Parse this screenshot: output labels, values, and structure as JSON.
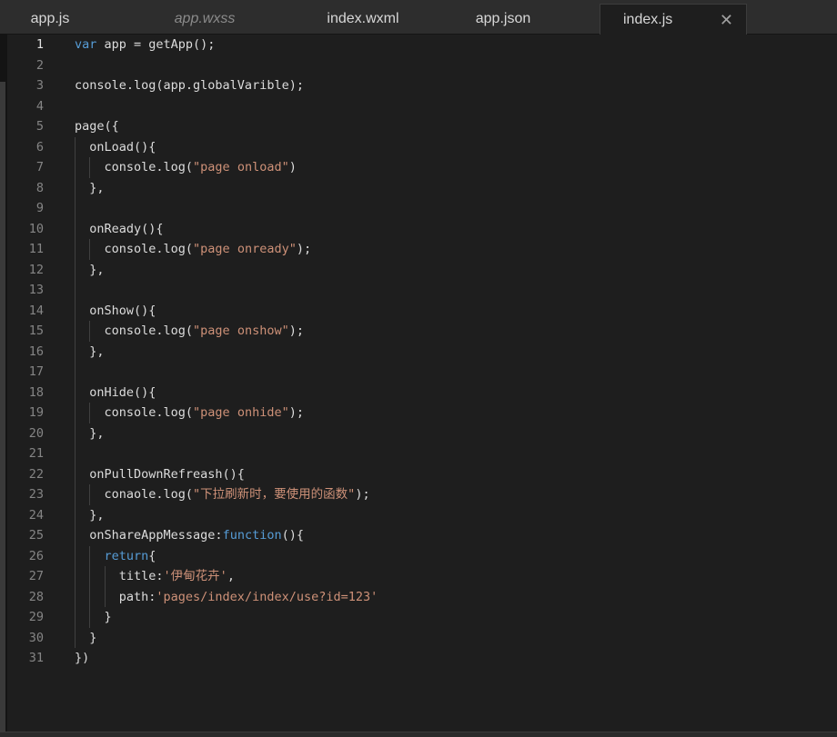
{
  "tabs": [
    {
      "label": "app.js"
    },
    {
      "label": "app.wxss"
    },
    {
      "label": "index.wxml"
    },
    {
      "label": "app.json"
    },
    {
      "label": "index.js"
    }
  ],
  "active_tab_close": "✕",
  "colors": {
    "background": "#1e1e1e",
    "keyword": "#569cd6",
    "string": "#ce9178",
    "text": "#dcdcdc",
    "line_number": "#858585"
  },
  "editor": {
    "current_line": 1,
    "lines": [
      [
        {
          "t": "kw",
          "s": "var"
        },
        {
          "t": "p",
          "s": " app = getApp();"
        }
      ],
      [],
      [
        {
          "t": "p",
          "s": "console.log(app.globalVarible);"
        }
      ],
      [],
      [
        {
          "t": "p",
          "s": "page({"
        }
      ],
      [
        {
          "t": "p",
          "s": "  onLoad(){"
        }
      ],
      [
        {
          "t": "p",
          "s": "    console.log("
        },
        {
          "t": "str",
          "s": "\"page onload\""
        },
        {
          "t": "p",
          "s": ")"
        }
      ],
      [
        {
          "t": "p",
          "s": "  },"
        }
      ],
      [],
      [
        {
          "t": "p",
          "s": "  onReady(){"
        }
      ],
      [
        {
          "t": "p",
          "s": "    console.log("
        },
        {
          "t": "str",
          "s": "\"page onready\""
        },
        {
          "t": "p",
          "s": ");"
        }
      ],
      [
        {
          "t": "p",
          "s": "  },"
        }
      ],
      [],
      [
        {
          "t": "p",
          "s": "  onShow(){"
        }
      ],
      [
        {
          "t": "p",
          "s": "    console.log("
        },
        {
          "t": "str",
          "s": "\"page onshow\""
        },
        {
          "t": "p",
          "s": ");"
        }
      ],
      [
        {
          "t": "p",
          "s": "  },"
        }
      ],
      [],
      [
        {
          "t": "p",
          "s": "  onHide(){"
        }
      ],
      [
        {
          "t": "p",
          "s": "    console.log("
        },
        {
          "t": "str",
          "s": "\"page onhide\""
        },
        {
          "t": "p",
          "s": ");"
        }
      ],
      [
        {
          "t": "p",
          "s": "  },"
        }
      ],
      [],
      [
        {
          "t": "p",
          "s": "  onPullDownRefreash(){"
        }
      ],
      [
        {
          "t": "p",
          "s": "    conaole.log("
        },
        {
          "t": "str",
          "s": "\"下拉刷新时，要使用的函数\""
        },
        {
          "t": "p",
          "s": ");"
        }
      ],
      [
        {
          "t": "p",
          "s": "  },"
        }
      ],
      [
        {
          "t": "p",
          "s": "  onShareAppMessage:"
        },
        {
          "t": "kw",
          "s": "function"
        },
        {
          "t": "p",
          "s": "(){"
        }
      ],
      [
        {
          "t": "kw",
          "s": "    return"
        },
        {
          "t": "p",
          "s": "{"
        }
      ],
      [
        {
          "t": "p",
          "s": "      title:"
        },
        {
          "t": "str",
          "s": "'伊甸花卉'"
        },
        {
          "t": "p",
          "s": ","
        }
      ],
      [
        {
          "t": "p",
          "s": "      path:"
        },
        {
          "t": "str",
          "s": "'pages/index/index/use?id=123'"
        }
      ],
      [
        {
          "t": "p",
          "s": "    }"
        }
      ],
      [
        {
          "t": "p",
          "s": "  }"
        }
      ],
      [
        {
          "t": "p",
          "s": "})"
        }
      ]
    ]
  }
}
